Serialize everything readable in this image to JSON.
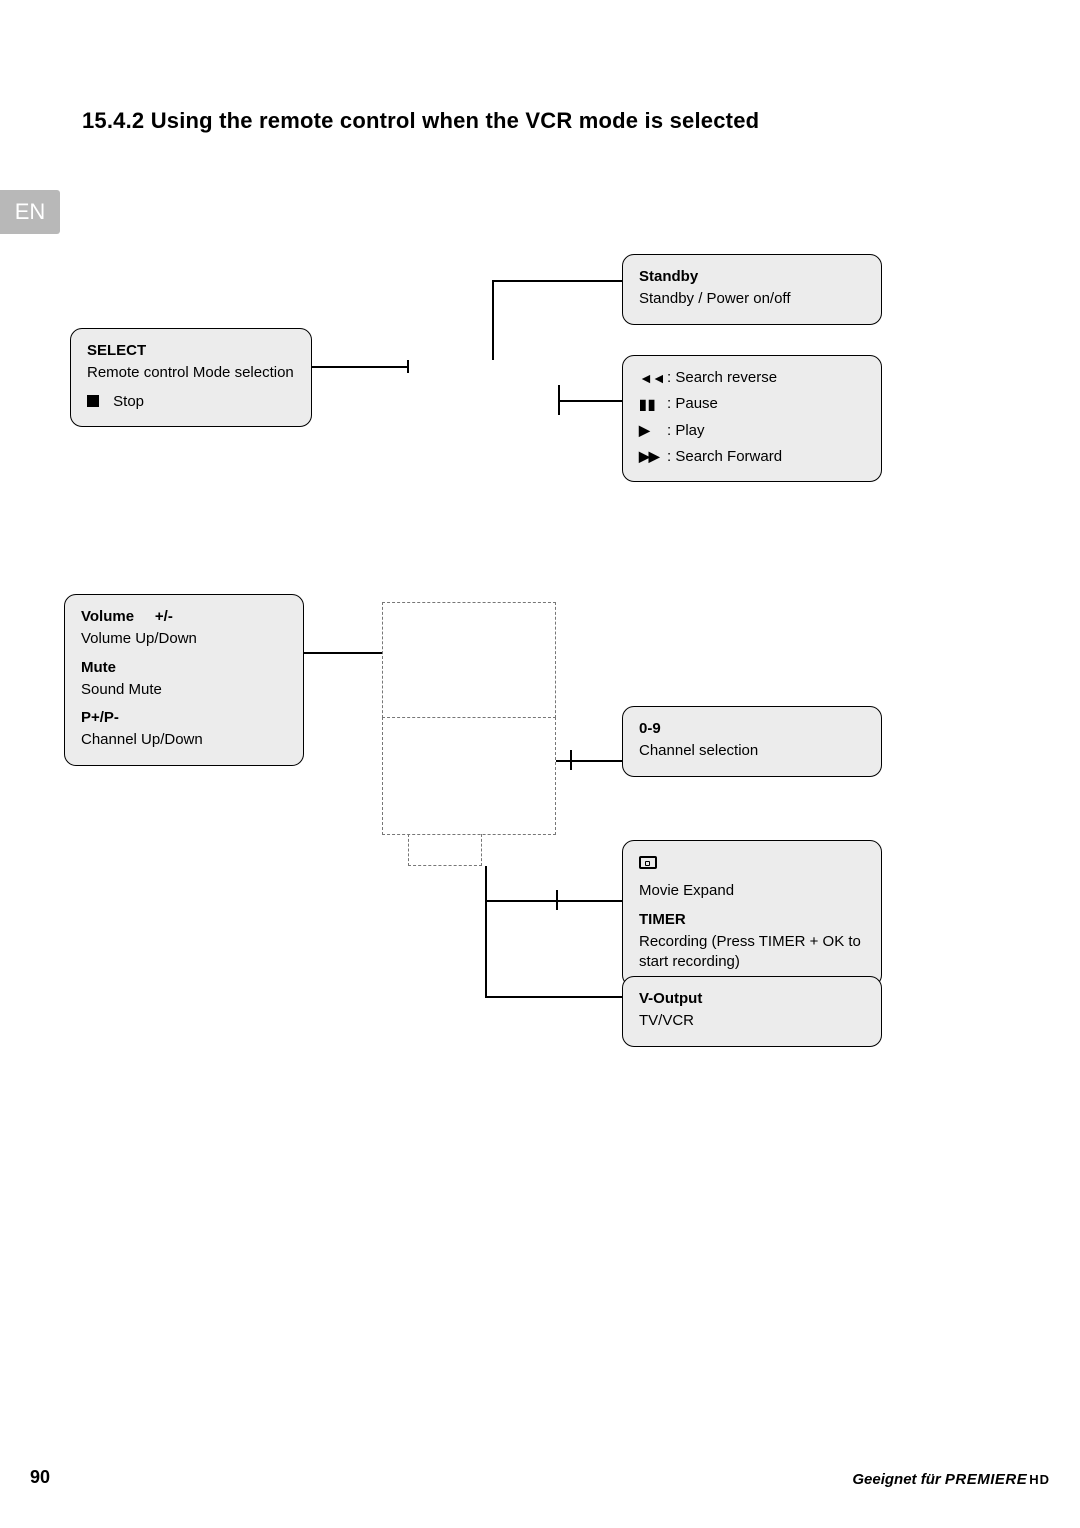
{
  "section_number": "15.4.2",
  "section_title": "Using the remote control when the VCR mode is selected",
  "lang_tab": "EN",
  "callouts": {
    "standby": {
      "title": "Standby",
      "desc": "Standby / Power on/off"
    },
    "select": {
      "title": "SELECT",
      "desc": "Remote control Mode selection",
      "stop_label": "Stop"
    },
    "transport": {
      "reverse": "Search reverse",
      "pause": "Pause",
      "play": "Play",
      "forward": "Search Forward"
    },
    "volume": {
      "vol_title": "Volume     +/-",
      "vol_desc": "Volume Up/Down",
      "mute_title": "Mute",
      "mute_desc": "Sound Mute",
      "chan_title": "P+/P-",
      "chan_desc": "Channel Up/Down"
    },
    "numbers": {
      "title": "0-9",
      "desc": "Channel selection"
    },
    "movie_timer": {
      "movie_desc": "Movie Expand",
      "timer_title": "TIMER",
      "timer_desc": "Recording (Press TIMER + OK to start recording)"
    },
    "voutput": {
      "title": "V-Output",
      "desc": "TV/VCR"
    }
  },
  "footer": {
    "page": "90",
    "text": "Geeignet für ",
    "brand": "PREMIERE",
    "brand_suffix": "HD"
  }
}
